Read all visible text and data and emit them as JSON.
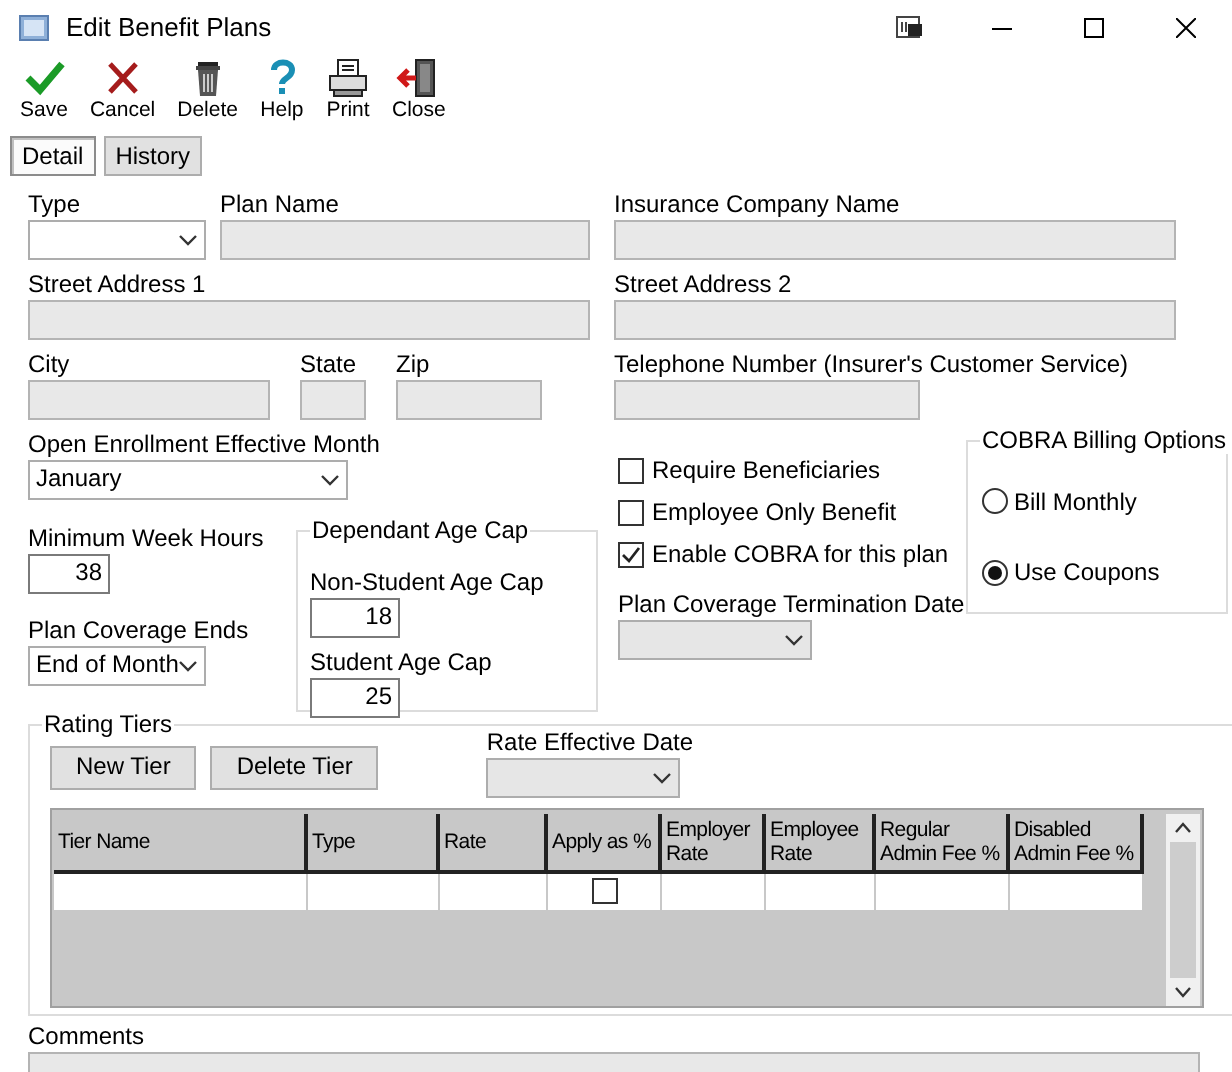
{
  "window": {
    "title": "Edit Benefit Plans"
  },
  "toolbar": [
    {
      "label": "Save",
      "kind": "save"
    },
    {
      "label": "Cancel",
      "kind": "cancel"
    },
    {
      "label": "Delete",
      "kind": "delete"
    },
    {
      "label": "Help",
      "kind": "help"
    },
    {
      "label": "Print",
      "kind": "print"
    },
    {
      "label": "Close",
      "kind": "close"
    }
  ],
  "tabs": [
    {
      "label": "Detail",
      "selected": true
    },
    {
      "label": "History",
      "selected": false
    }
  ],
  "general": {
    "type": {
      "label": "Type",
      "kind": "combo",
      "disabled": false
    },
    "plan_name": {
      "label": "Plan Name",
      "kind": "text",
      "disabled": true
    },
    "insurance_company_name": {
      "label": "Insurance Company Name",
      "kind": "text",
      "disabled": true
    },
    "street_address_1": {
      "label": "Street Address 1",
      "kind": "text",
      "disabled": true
    },
    "street_address_2": {
      "label": "Street Address 2",
      "kind": "text",
      "disabled": true
    },
    "city": {
      "label": "City",
      "kind": "text",
      "disabled": true
    },
    "state": {
      "label": "State",
      "kind": "text",
      "disabled": true
    },
    "zip": {
      "label": "Zip",
      "kind": "text",
      "disabled": true
    },
    "telephone": {
      "label": "Telephone Number (Insurer's Customer Service)",
      "kind": "text",
      "disabled": true
    },
    "open_enrollment_month": {
      "label": "Open Enrollment Effective Month",
      "kind": "combo",
      "disabled": false,
      "value": "January"
    },
    "minimum_week_hours": {
      "label": "Minimum Week Hours",
      "kind": "text",
      "disabled": false,
      "value": "38"
    },
    "plan_coverage_ends": {
      "label": "Plan Coverage Ends",
      "kind": "combo",
      "disabled": false,
      "value": "End of Month"
    }
  },
  "dependant_age_cap": {
    "title": "Dependant Age Cap",
    "non_student": {
      "label": "Non-Student Age Cap",
      "kind": "text",
      "disabled": false,
      "value": "18"
    },
    "student": {
      "label": "Student Age Cap",
      "kind": "text",
      "disabled": false,
      "value": "25"
    }
  },
  "options": [
    {
      "label": "Require Beneficiaries",
      "checked": false
    },
    {
      "label": "Employee Only Benefit",
      "checked": false
    },
    {
      "label": "Enable COBRA for this plan",
      "checked": true
    }
  ],
  "plan_coverage_termination_date": {
    "label": "Plan Coverage Termination Date",
    "kind": "combo",
    "disabled": true
  },
  "cobra_billing": {
    "title": "COBRA Billing Options",
    "options": [
      {
        "label": "Bill Monthly",
        "selected": false
      },
      {
        "label": "Use Coupons",
        "selected": true
      }
    ]
  },
  "rating_tiers": {
    "title": "Rating Tiers",
    "buttons": [
      "New Tier",
      "Delete Tier"
    ],
    "rate_effective_date": {
      "label": "Rate Effective Date",
      "kind": "combo",
      "disabled": true
    },
    "table": {
      "columns": [
        "Tier Name",
        "Type",
        "Rate",
        "Apply as %",
        "Employer Rate",
        "Employee Rate",
        "Regular Admin Fee %",
        "Disabled Admin Fee %"
      ],
      "rows": [
        {
          "apply_as_percent": false
        }
      ]
    }
  },
  "comments": {
    "label": "Comments",
    "kind": "text",
    "disabled": true
  }
}
